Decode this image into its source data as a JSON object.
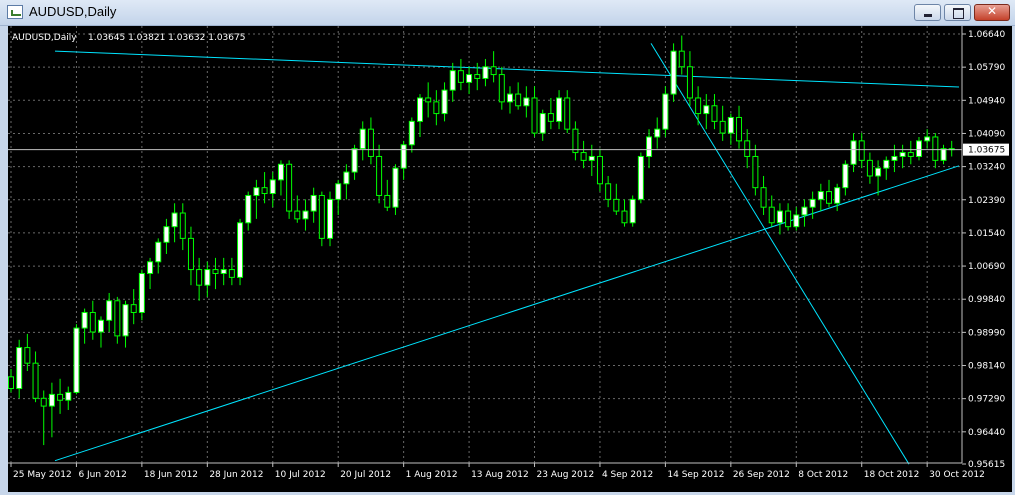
{
  "window": {
    "title": "AUDUSD,Daily"
  },
  "chart_data": {
    "type": "candlestick",
    "title": "AUDUSD,Daily",
    "ohlc_label": "1.03645 1.03821 1.03632 1.03675",
    "last_price": 1.03675,
    "last_price_label": "1.03675",
    "ylim": [
      0.95615,
      1.0664
    ],
    "y_ticks": [
      "1.06640",
      "1.05790",
      "1.04940",
      "1.04090",
      "1.03240",
      "1.02390",
      "1.01540",
      "1.00690",
      "0.99840",
      "0.98990",
      "0.98140",
      "0.97290",
      "0.96440",
      "0.95615"
    ],
    "x_ticks": [
      "25 May 2012",
      "6 Jun 2012",
      "18 Jun 2012",
      "28 Jun 2012",
      "10 Jul 2012",
      "20 Jul 2012",
      "1 Aug 2012",
      "13 Aug 2012",
      "23 Aug 2012",
      "4 Sep 2012",
      "14 Sep 2012",
      "26 Sep 2012",
      "8 Oct 2012",
      "18 Oct 2012",
      "30 Oct 2012"
    ],
    "grid": true,
    "colors": {
      "background": "#000000",
      "bull": "#ffffff",
      "bear": "#000000",
      "wick": "#00ff00",
      "grid": "#c0c0c0",
      "trendline": "#00e5ff"
    },
    "candles": [
      [
        0.9785,
        0.9805,
        0.9745,
        0.9755
      ],
      [
        0.9755,
        0.988,
        0.973,
        0.986
      ],
      [
        0.986,
        0.9895,
        0.98,
        0.982
      ],
      [
        0.982,
        0.985,
        0.972,
        0.973
      ],
      [
        0.973,
        0.975,
        0.961,
        0.971
      ],
      [
        0.971,
        0.977,
        0.963,
        0.974
      ],
      [
        0.974,
        0.978,
        0.969,
        0.9725
      ],
      [
        0.9725,
        0.976,
        0.97,
        0.9745
      ],
      [
        0.9745,
        0.992,
        0.974,
        0.991
      ],
      [
        0.991,
        0.996,
        0.987,
        0.995
      ],
      [
        0.995,
        0.998,
        0.988,
        0.99
      ],
      [
        0.99,
        0.994,
        0.986,
        0.993
      ],
      [
        0.993,
        1.0,
        0.99,
        0.998
      ],
      [
        0.998,
        0.999,
        0.987,
        0.989
      ],
      [
        0.989,
        0.998,
        0.986,
        0.997
      ],
      [
        0.997,
        1.001,
        0.992,
        0.995
      ],
      [
        0.995,
        1.006,
        0.993,
        1.005
      ],
      [
        1.005,
        1.009,
        1.001,
        1.008
      ],
      [
        1.008,
        1.014,
        1.005,
        1.013
      ],
      [
        1.013,
        1.019,
        1.01,
        1.017
      ],
      [
        1.017,
        1.023,
        1.013,
        1.0205
      ],
      [
        1.0205,
        1.023,
        1.011,
        1.014
      ],
      [
        1.014,
        1.017,
        1.002,
        1.006
      ],
      [
        1.006,
        1.009,
        0.998,
        1.002
      ],
      [
        1.002,
        1.008,
        0.999,
        1.006
      ],
      [
        1.006,
        1.009,
        1.001,
        1.005
      ],
      [
        1.005,
        1.009,
        1.002,
        1.006
      ],
      [
        1.006,
        1.009,
        1.002,
        1.004
      ],
      [
        1.004,
        1.019,
        1.002,
        1.018
      ],
      [
        1.018,
        1.026,
        1.016,
        1.025
      ],
      [
        1.025,
        1.029,
        1.019,
        1.027
      ],
      [
        1.027,
        1.031,
        1.023,
        1.0255
      ],
      [
        1.0255,
        1.031,
        1.022,
        1.029
      ],
      [
        1.029,
        1.034,
        1.025,
        1.033
      ],
      [
        1.033,
        1.034,
        1.019,
        1.021
      ],
      [
        1.021,
        1.025,
        1.018,
        1.019
      ],
      [
        1.019,
        1.024,
        1.016,
        1.021
      ],
      [
        1.021,
        1.027,
        1.018,
        1.025
      ],
      [
        1.025,
        1.026,
        1.012,
        1.014
      ],
      [
        1.014,
        1.026,
        1.012,
        1.024
      ],
      [
        1.024,
        1.029,
        1.02,
        1.028
      ],
      [
        1.028,
        1.033,
        1.024,
        1.031
      ],
      [
        1.031,
        1.038,
        1.029,
        1.037
      ],
      [
        1.037,
        1.044,
        1.034,
        1.042
      ],
      [
        1.042,
        1.045,
        1.033,
        1.035
      ],
      [
        1.035,
        1.038,
        1.023,
        1.025
      ],
      [
        1.025,
        1.029,
        1.021,
        1.022
      ],
      [
        1.022,
        1.033,
        1.02,
        1.032
      ],
      [
        1.032,
        1.039,
        1.029,
        1.038
      ],
      [
        1.038,
        1.045,
        1.036,
        1.044
      ],
      [
        1.044,
        1.051,
        1.04,
        1.05
      ],
      [
        1.05,
        1.054,
        1.045,
        1.049
      ],
      [
        1.049,
        1.052,
        1.043,
        1.046
      ],
      [
        1.046,
        1.054,
        1.044,
        1.052
      ],
      [
        1.052,
        1.059,
        1.049,
        1.057
      ],
      [
        1.057,
        1.06,
        1.052,
        1.054
      ],
      [
        1.054,
        1.058,
        1.051,
        1.056
      ],
      [
        1.056,
        1.059,
        1.052,
        1.055
      ],
      [
        1.055,
        1.06,
        1.053,
        1.058
      ],
      [
        1.058,
        1.062,
        1.054,
        1.056
      ],
      [
        1.056,
        1.058,
        1.047,
        1.049
      ],
      [
        1.049,
        1.053,
        1.046,
        1.051
      ],
      [
        1.051,
        1.054,
        1.047,
        1.048
      ],
      [
        1.048,
        1.053,
        1.045,
        1.05
      ],
      [
        1.05,
        1.053,
        1.04,
        1.041
      ],
      [
        1.041,
        1.047,
        1.039,
        1.046
      ],
      [
        1.046,
        1.05,
        1.042,
        1.044
      ],
      [
        1.044,
        1.052,
        1.042,
        1.05
      ],
      [
        1.05,
        1.052,
        1.041,
        1.042
      ],
      [
        1.042,
        1.044,
        1.034,
        1.036
      ],
      [
        1.036,
        1.039,
        1.032,
        1.034
      ],
      [
        1.034,
        1.038,
        1.03,
        1.035
      ],
      [
        1.035,
        1.037,
        1.026,
        1.028
      ],
      [
        1.028,
        1.03,
        1.022,
        1.024
      ],
      [
        1.024,
        1.028,
        1.02,
        1.021
      ],
      [
        1.021,
        1.024,
        1.017,
        1.018
      ],
      [
        1.018,
        1.025,
        1.017,
        1.024
      ],
      [
        1.024,
        1.036,
        1.023,
        1.035
      ],
      [
        1.035,
        1.042,
        1.032,
        1.04
      ],
      [
        1.04,
        1.045,
        1.037,
        1.042
      ],
      [
        1.042,
        1.053,
        1.04,
        1.051
      ],
      [
        1.051,
        1.064,
        1.049,
        1.062
      ],
      [
        1.062,
        1.066,
        1.056,
        1.058
      ],
      [
        1.058,
        1.062,
        1.048,
        1.05
      ],
      [
        1.05,
        1.053,
        1.043,
        1.046
      ],
      [
        1.046,
        1.051,
        1.042,
        1.048
      ],
      [
        1.048,
        1.051,
        1.042,
        1.044
      ],
      [
        1.044,
        1.048,
        1.039,
        1.041
      ],
      [
        1.041,
        1.046,
        1.038,
        1.045
      ],
      [
        1.045,
        1.048,
        1.037,
        1.039
      ],
      [
        1.039,
        1.042,
        1.032,
        1.035
      ],
      [
        1.035,
        1.038,
        1.025,
        1.027
      ],
      [
        1.027,
        1.03,
        1.02,
        1.022
      ],
      [
        1.022,
        1.025,
        1.017,
        1.018
      ],
      [
        1.018,
        1.023,
        1.015,
        1.021
      ],
      [
        1.021,
        1.023,
        1.016,
        1.017
      ],
      [
        1.017,
        1.022,
        1.016,
        1.02
      ],
      [
        1.02,
        1.024,
        1.017,
        1.022
      ],
      [
        1.022,
        1.026,
        1.019,
        1.024
      ],
      [
        1.024,
        1.028,
        1.021,
        1.026
      ],
      [
        1.026,
        1.029,
        1.022,
        1.023
      ],
      [
        1.023,
        1.028,
        1.021,
        1.027
      ],
      [
        1.027,
        1.034,
        1.025,
        1.033
      ],
      [
        1.033,
        1.041,
        1.031,
        1.039
      ],
      [
        1.039,
        1.041,
        1.032,
        1.034
      ],
      [
        1.034,
        1.036,
        1.028,
        1.03
      ],
      [
        1.03,
        1.034,
        1.025,
        1.032
      ],
      [
        1.032,
        1.035,
        1.029,
        1.034
      ],
      [
        1.034,
        1.038,
        1.031,
        1.035
      ],
      [
        1.035,
        1.038,
        1.032,
        1.036
      ],
      [
        1.036,
        1.039,
        1.033,
        1.035
      ],
      [
        1.035,
        1.04,
        1.034,
        1.039
      ],
      [
        1.039,
        1.042,
        1.037,
        1.04
      ],
      [
        1.04,
        1.041,
        1.032,
        1.034
      ],
      [
        1.034,
        1.038,
        1.033,
        1.037
      ],
      [
        1.037,
        1.039,
        1.035,
        1.0368
      ]
    ],
    "trendlines": [
      {
        "start": [
          47,
          1.062
        ],
        "end": [
          951,
          1.0528
        ]
      },
      {
        "start": [
          47,
          0.957
        ],
        "end": [
          951,
          1.0326
        ]
      },
      {
        "start": [
          643,
          1.064
        ],
        "end": [
          901,
          0.9561
        ]
      }
    ]
  }
}
